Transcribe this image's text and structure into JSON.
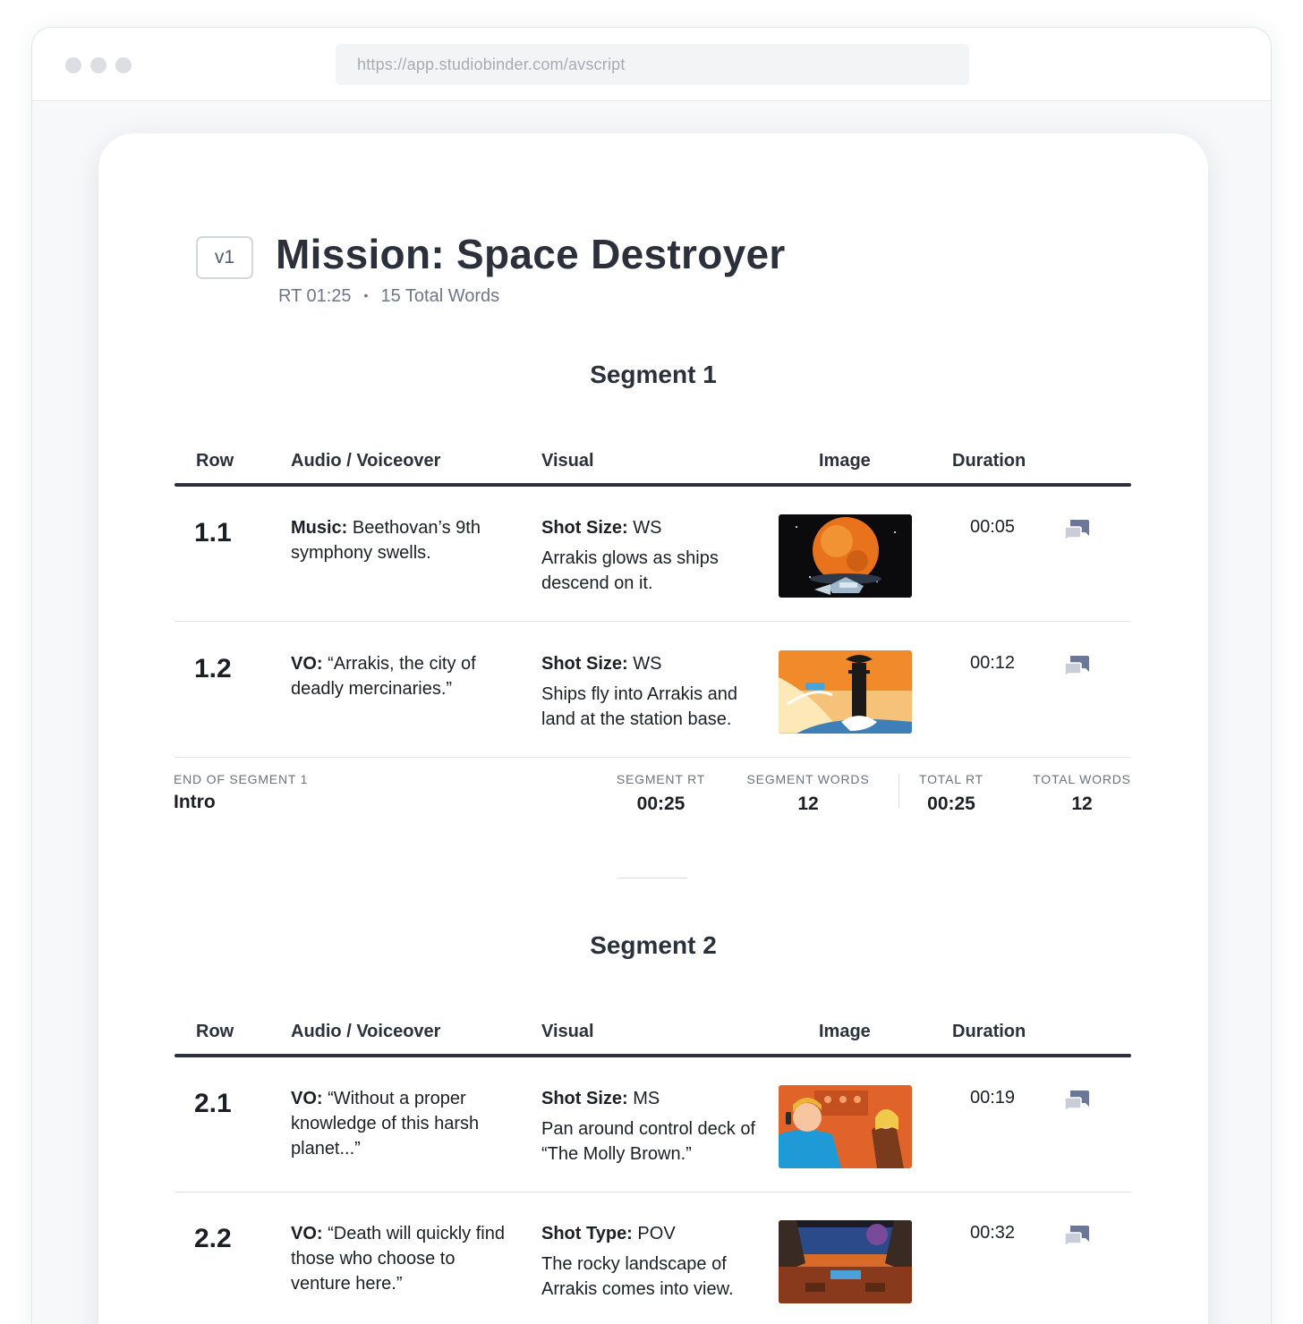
{
  "browser": {
    "url": "https://app.studiobinder.com/avscript"
  },
  "document": {
    "version": "v1",
    "title": "Mission: Space Destroyer",
    "runtime": "RT 01:25",
    "separator": "•",
    "total_words": "15 Total Words"
  },
  "columns": {
    "row": "Row",
    "audio": "Audio / Voiceover",
    "visual": "Visual",
    "image": "Image",
    "duration": "Duration"
  },
  "segments": [
    {
      "title": "Segment 1",
      "rows": [
        {
          "num": "1.1",
          "audio_label": "Music:",
          "audio_text": " Beethovan’s 9th symphony swells.",
          "visual_label": "Shot Size:",
          "visual_value": " WS",
          "visual_desc": "Arrakis glows as ships descend on it.",
          "image": "orange-planet-ships-illustration",
          "duration": "00:05",
          "comment_icon": "comment-icon"
        },
        {
          "num": "1.2",
          "audio_label": "VO:",
          "audio_text": " “Arrakis, the city of deadly mercinaries.”",
          "visual_label": "Shot Size:",
          "visual_value": " WS",
          "visual_desc": "Ships fly into Arrakis and land at the station base.",
          "image": "station-tower-ships-illustration",
          "duration": "00:12",
          "comment_icon": "comment-icon"
        }
      ],
      "footer": {
        "label": "END OF SEGMENT 1",
        "name": "Intro",
        "segment_rt_label": "SEGMENT RT",
        "segment_rt": "00:25",
        "segment_words_label": "SEGMENT WORDS",
        "segment_words": "12",
        "total_rt_label": "TOTAL RT",
        "total_rt": "00:25",
        "total_words_label": "TOTAL WORDS",
        "total_words": "12"
      }
    },
    {
      "title": "Segment 2",
      "rows": [
        {
          "num": "2.1",
          "audio_label": "VO:",
          "audio_text": " “Without a proper knowledge of this harsh planet...”",
          "visual_label": "Shot Size:",
          "visual_value": " MS",
          "visual_desc": "Pan around control deck of “The Molly Brown.”",
          "image": "control-deck-crew-illustration",
          "duration": "00:19",
          "comment_icon": "comment-icon"
        },
        {
          "num": "2.2",
          "audio_label": "VO:",
          "audio_text": " “Death will quickly find those who choose to venture here.”",
          "visual_label": "Shot Type:",
          "visual_value": " POV",
          "visual_desc": "The rocky landscape of Arrakis comes into view.",
          "image": "cockpit-landscape-view-illustration",
          "duration": "00:32",
          "comment_icon": "comment-icon"
        }
      ]
    }
  ],
  "colors": {
    "text_dark": "#2b303b",
    "text_muted": "#6e7787",
    "icon_slate": "#6b7796",
    "border": "#e1e3e8"
  }
}
